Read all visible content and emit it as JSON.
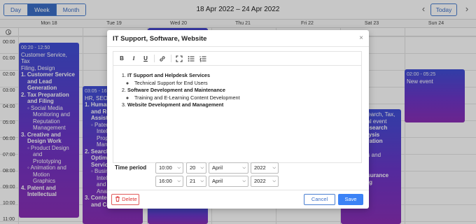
{
  "toolbar": {
    "views": [
      "Day",
      "Week",
      "Month"
    ],
    "active_view": "Week",
    "range_title": "18 Apr 2022 – 24 Apr 2022",
    "prev_icon": "chevron-left-icon",
    "next_icon": "chevron-right-icon",
    "today_label": "Today"
  },
  "calendar": {
    "days": [
      "Mon 18",
      "Tue 19",
      "Wed 20",
      "Thu 21",
      "Fri 22",
      "Sat 23",
      "Sun 24"
    ],
    "hours": [
      "00:00",
      "01:00",
      "02:00",
      "03:00",
      "04:00",
      "05:00",
      "06:00",
      "07:00",
      "08:00",
      "09:00",
      "10:00",
      "11:00"
    ],
    "events": {
      "mon": {
        "time": "00:20 - 12:50",
        "lines": [
          "Customer Service, Tax",
          "Filing, Design"
        ],
        "items": [
          "1. Customer Service",
          "and Lead",
          "Generation",
          "2. Tax Preparation",
          "and Filing",
          "◦ Social Media",
          "Monitoring and",
          "Reputation",
          "Management",
          "3. Creative and",
          "Design Work",
          "◦ Product Design",
          "and",
          "Prototyping",
          "◦ Animation and",
          "Motion",
          "Graphics",
          "4. Patent and",
          "Intellectual"
        ]
      },
      "tue": {
        "time": "03:05 - 16:",
        "lines": [
          "HR, SEO, C"
        ],
        "items": [
          "1. Human",
          "and Rec",
          "Assista",
          "◦ Paten",
          "Intelle",
          "Prope",
          "Manag",
          "2. Search",
          "Optimiz",
          "Service",
          "◦ Busin",
          "Intelli",
          "and D",
          "Analy",
          "3. Conte",
          "and Copywriting"
        ]
      },
      "sat": {
        "lines": [
          "Search, Tax,",
          "nal event"
        ],
        "items": [
          "research",
          "alysis",
          "aration",
          "ns and",
          "ssurance",
          "ing"
        ]
      },
      "sun": {
        "time": "02:00 - 05:25",
        "title": "New event"
      }
    }
  },
  "modal": {
    "title": "IT Support, Software, Website",
    "close_icon": "close-icon",
    "editor_tools": [
      "bold-icon",
      "italic-icon",
      "underline-icon",
      "link-icon",
      "fullscreen-icon",
      "bulleted-list-icon",
      "numbered-list-icon"
    ],
    "content": {
      "item1": "IT Support and Helpdesk Services",
      "item1_sub": "Technical Support for End Users",
      "item2": "Software Development and Maintenance",
      "item2_sub": "Training and E-Learning Content Development",
      "item3": "Website Development and Management"
    },
    "time_period_label": "Time period",
    "start": {
      "time": "10:00",
      "day": "20",
      "month": "April",
      "year": "2022"
    },
    "end": {
      "time": "16:00",
      "day": "21",
      "month": "April",
      "year": "2022"
    },
    "delete_label": "Delete",
    "cancel_label": "Cancel",
    "save_label": "Save"
  }
}
